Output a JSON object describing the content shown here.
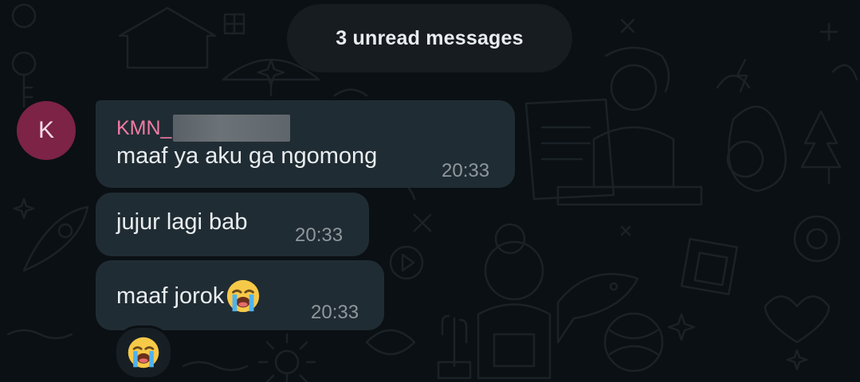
{
  "banner": {
    "unread_label": "3 unread messages"
  },
  "sender": {
    "avatar_letter": "K",
    "name_visible": "KMN_"
  },
  "messages": [
    {
      "text": "maaf ya aku ga ngomong",
      "time": "20:33"
    },
    {
      "text": "jujur lagi bab",
      "time": "20:33"
    },
    {
      "text": "maaf jorok",
      "time": "20:33",
      "emoji": "loudly-crying-face"
    }
  ],
  "reaction": {
    "emoji": "loudly-crying-face"
  },
  "colors": {
    "background": "#0b1014",
    "bubble": "#202c33",
    "sender_name": "#f07ba6",
    "avatar": "#7c2346",
    "timestamp": "#8e979c"
  }
}
